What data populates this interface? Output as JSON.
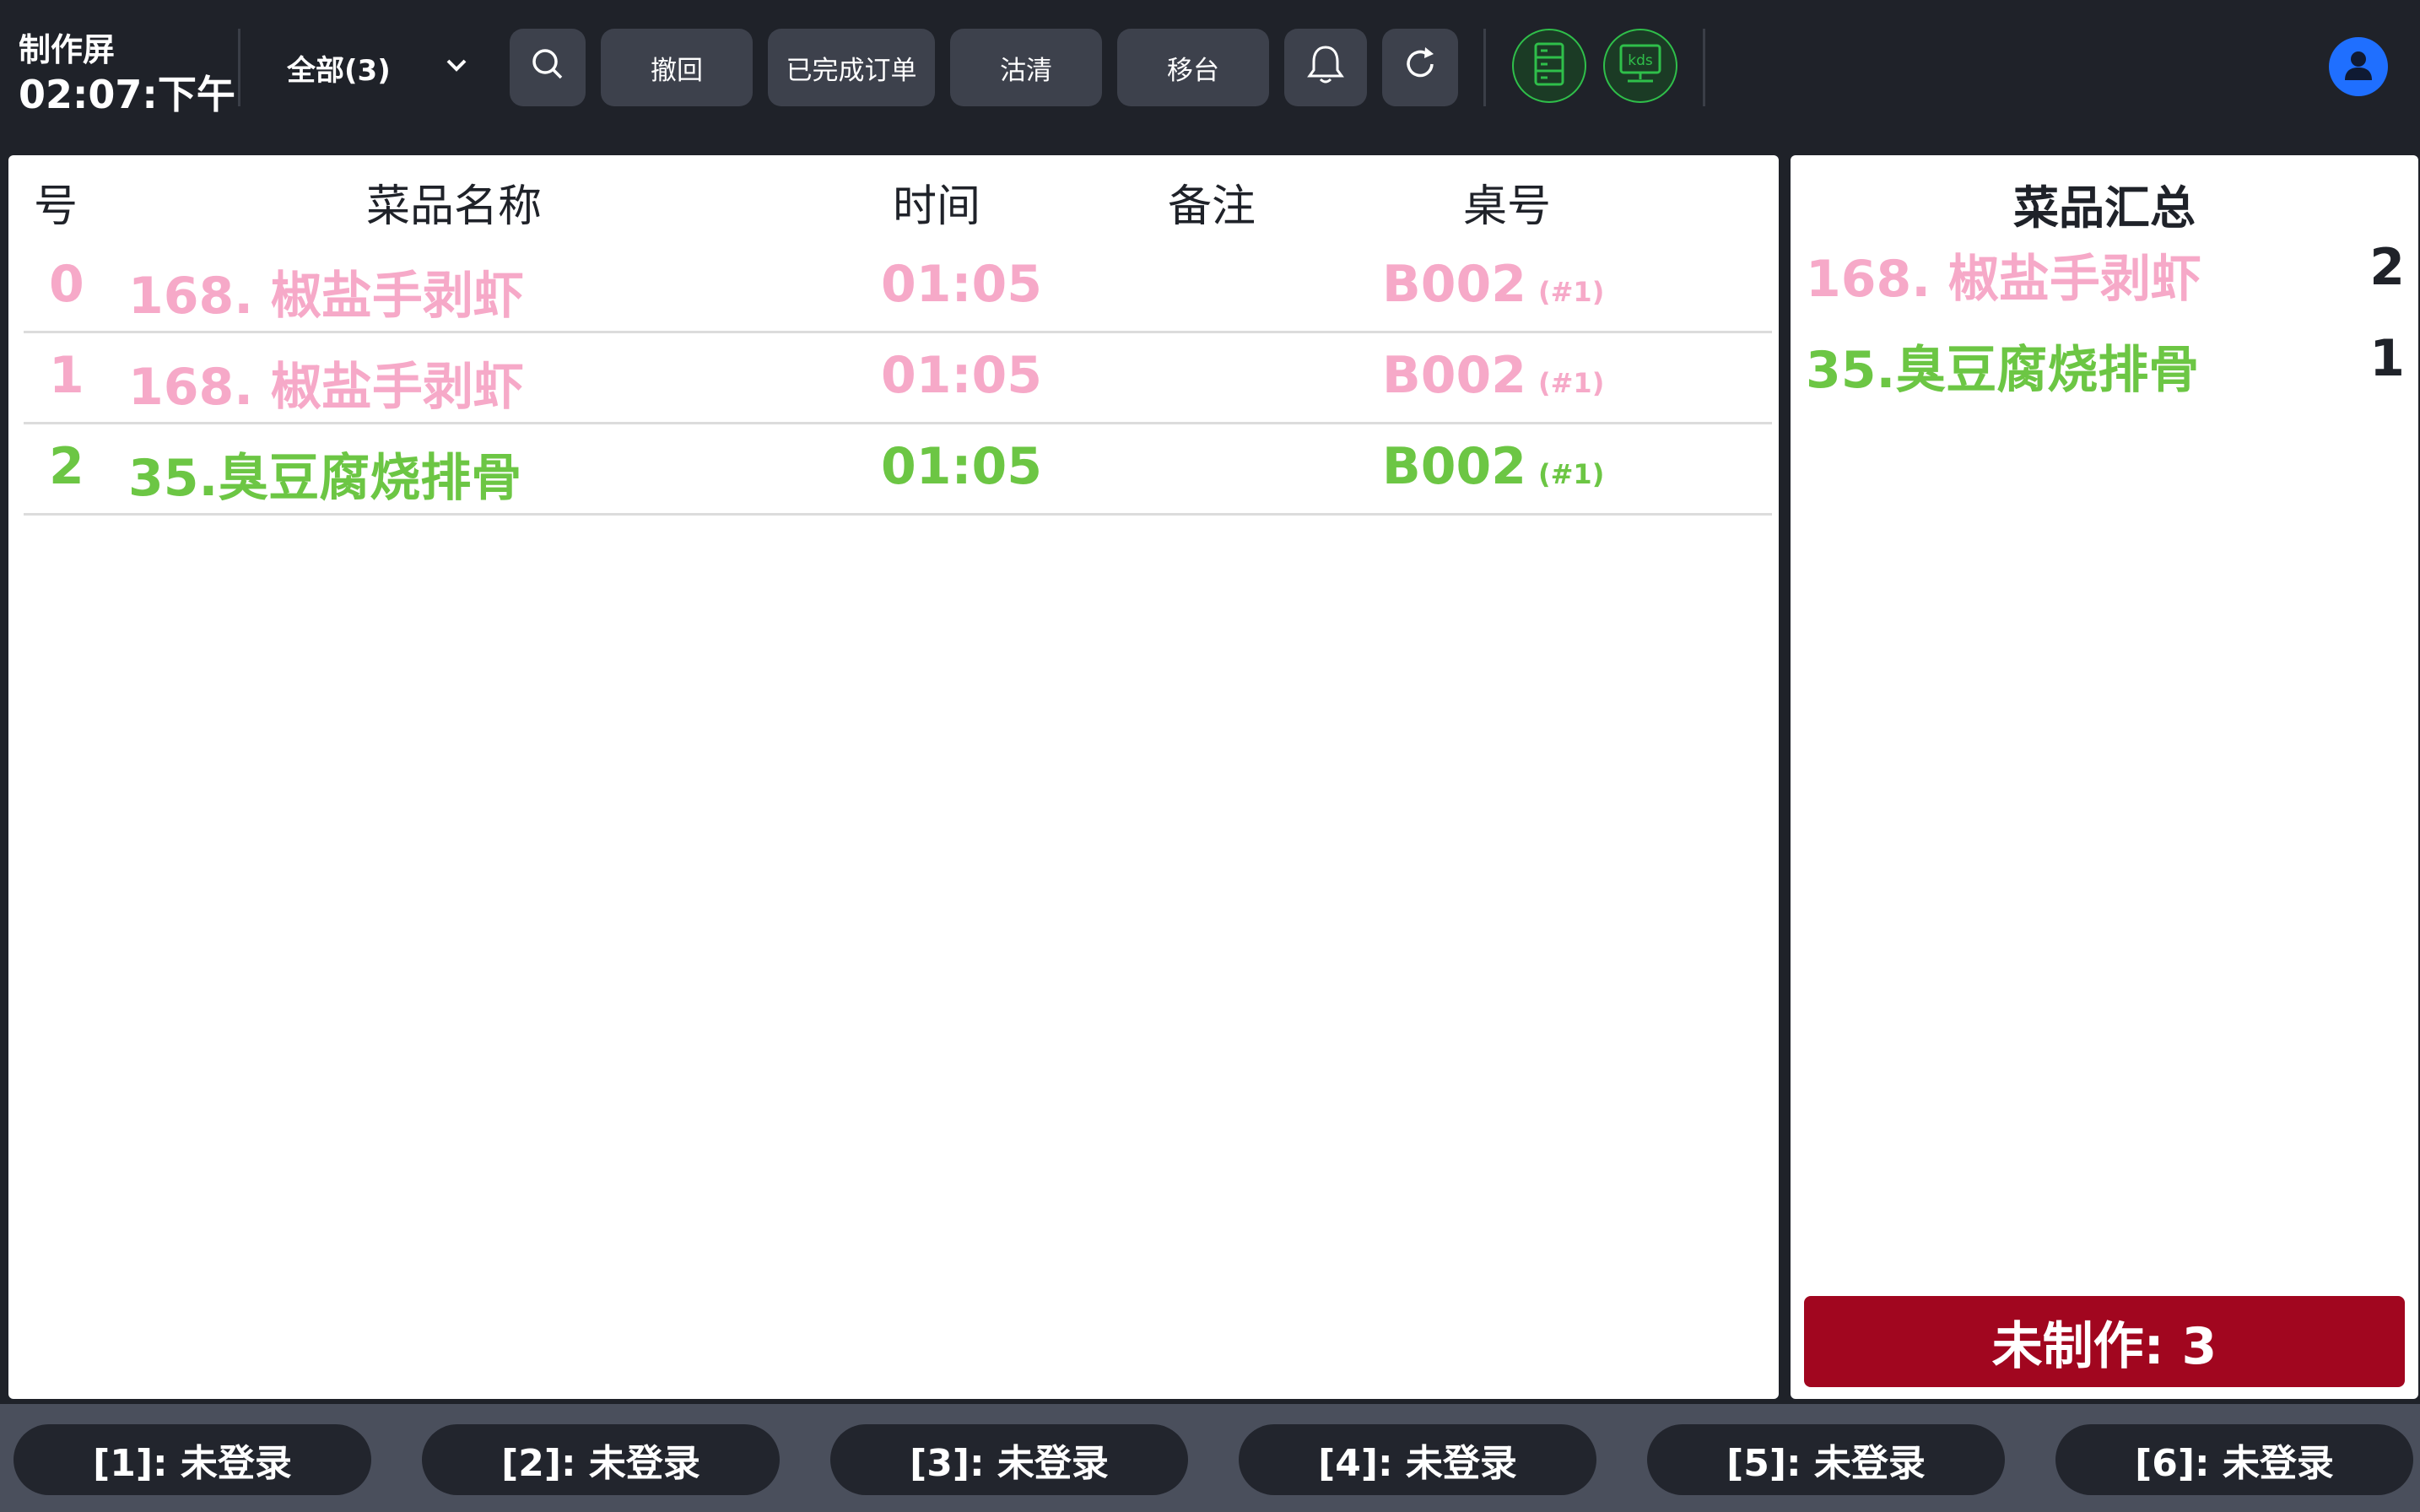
{
  "header": {
    "app_title": "制作屏",
    "clock": "02:07:下午",
    "filter_label": "全部(3)",
    "buttons": {
      "undo": "撤回",
      "completed_orders": "已完成订单",
      "sold_out": "沽清",
      "move_table": "移台"
    },
    "kds_label": "kds"
  },
  "orders": {
    "columns": [
      "号",
      "菜品名称",
      "时间",
      "备注",
      "桌号"
    ],
    "rows": [
      {
        "num": "0",
        "dish": "168. 椒盐手剥虾",
        "time": "01:05",
        "note": "",
        "table": "B002",
        "seat": "(#1)",
        "color": "#f6a9c8"
      },
      {
        "num": "1",
        "dish": "168. 椒盐手剥虾",
        "time": "01:05",
        "note": "",
        "table": "B002",
        "seat": "(#1)",
        "color": "#f6a9c8"
      },
      {
        "num": "2",
        "dish": "35.臭豆腐烧排骨",
        "time": "01:05",
        "note": "",
        "table": "B002",
        "seat": "(#1)",
        "color": "#6cc644"
      }
    ]
  },
  "summary": {
    "title": "菜品汇总",
    "items": [
      {
        "name": "168. 椒盐手剥虾",
        "qty": "2",
        "color": "#f6a9c8"
      },
      {
        "name": "35.臭豆腐烧排骨",
        "qty": "1",
        "color": "#6cc644"
      }
    ],
    "pending_label": "未制作: 3"
  },
  "stations": [
    {
      "label": "[1]: 未登录"
    },
    {
      "label": "[2]: 未登录"
    },
    {
      "label": "[3]: 未登录"
    },
    {
      "label": "[4]: 未登录"
    },
    {
      "label": "[5]: 未登录"
    },
    {
      "label": "[6]: 未登录"
    }
  ],
  "colors": {
    "accent_green": "#2fbf4a",
    "pending_red": "#a1061f",
    "avatar_blue": "#1f6fff"
  }
}
